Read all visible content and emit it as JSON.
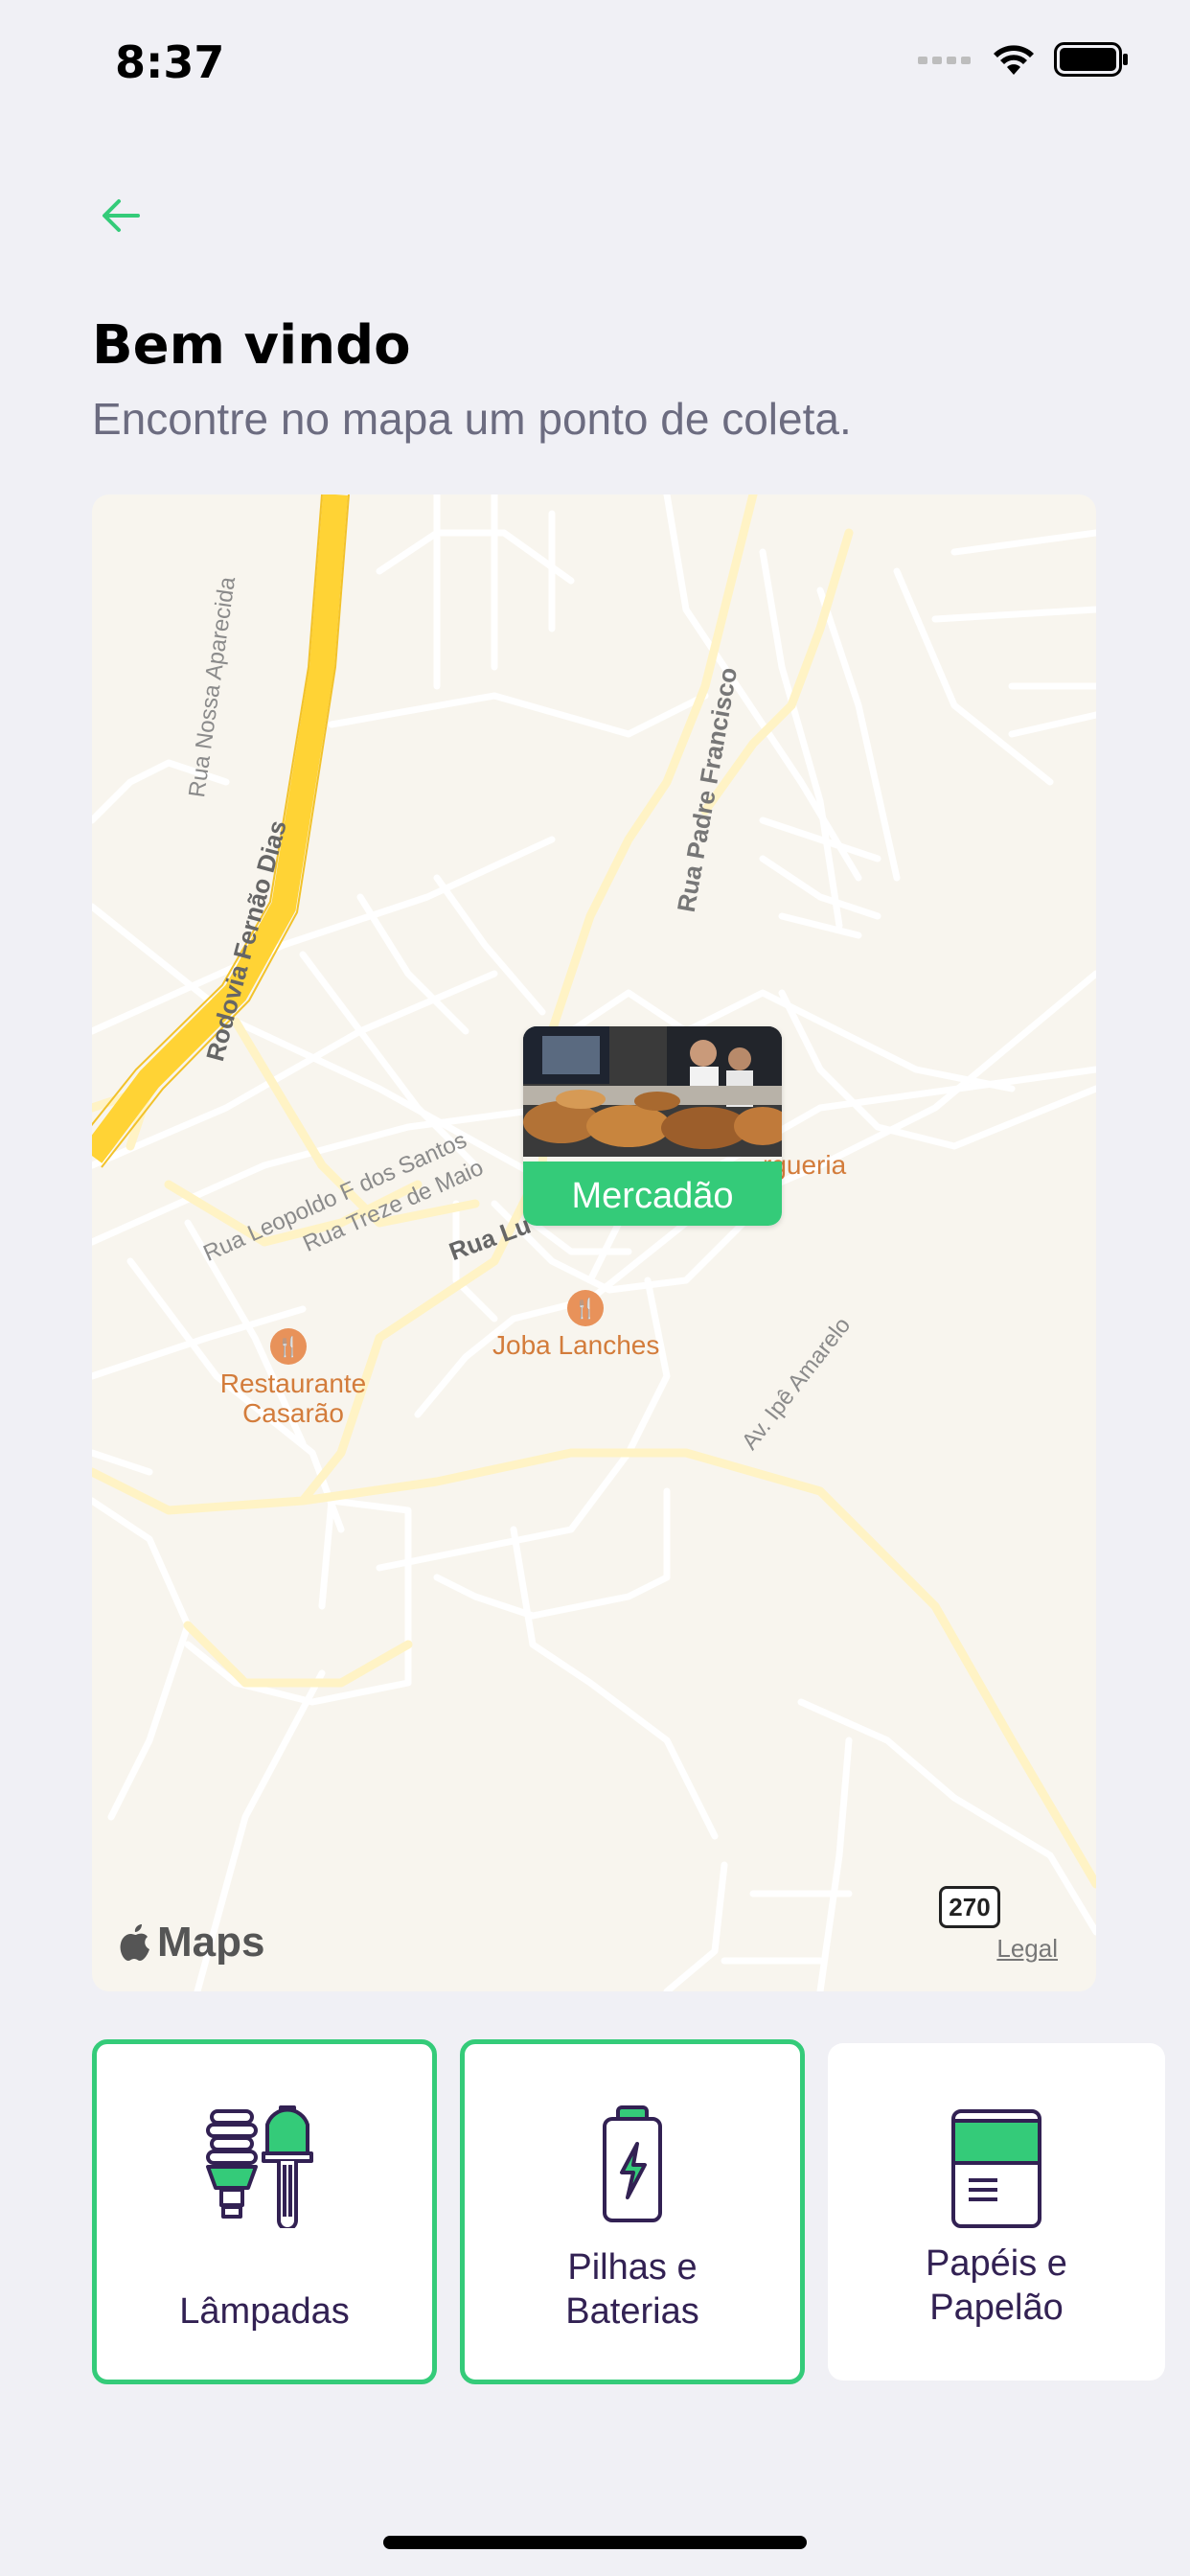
{
  "status": {
    "time": "8:37"
  },
  "header": {
    "title": "Bem vindo",
    "subtitle": "Encontre no mapa um ponto de coleta."
  },
  "map": {
    "brand": "Maps",
    "legal": "Legal",
    "route_number": "270",
    "streets": {
      "nossa_aparecida": "Rua Nossa Aparecida",
      "fernao_dias": "Rodovia Fernão Dias",
      "padre_francisco": "Rua Padre Francisco",
      "leopoldo": "Rua Leopoldo F dos Santos",
      "treze_de_maio": "Rua Treze de Maio",
      "rua_lu": "Rua Lu",
      "ipe_amarelo": "Av. Ipê Amarelo"
    },
    "pois": {
      "restaurante": "Restaurante\nCasarão",
      "joba": "Joba Lanches",
      "hamburgueria": "rgueria"
    },
    "marker": {
      "label": "Mercadão"
    }
  },
  "items": [
    {
      "label": "Lâmpadas",
      "selected": true,
      "icon": "lamp-icon"
    },
    {
      "label": "Pilhas e\nBaterias",
      "selected": true,
      "icon": "battery-icon"
    },
    {
      "label": "Papéis e\nPapelão",
      "selected": false,
      "icon": "paper-icon"
    }
  ],
  "colors": {
    "accent": "#34CB79",
    "text_title": "#322153",
    "subtitle": "#6C6C80",
    "background": "#F0F0F5"
  }
}
